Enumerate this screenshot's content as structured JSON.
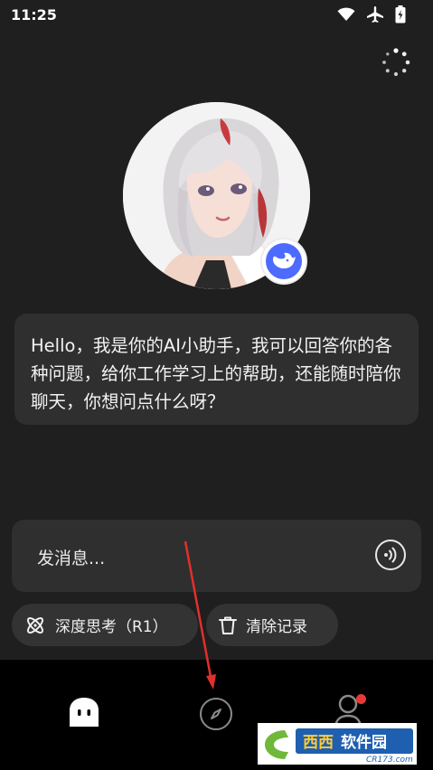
{
  "status_bar": {
    "time": "11:25"
  },
  "greeting": {
    "text": "Hello，我是你的AI小助手，我可以回答你的各种问题，给你工作学习上的帮助，还能随时陪你聊天，你想问点什么呀？"
  },
  "input": {
    "placeholder": "发消息..."
  },
  "chips": {
    "deep_think_label": "深度思考（R1）",
    "clear_label": "清除记录"
  },
  "icons": {
    "status": [
      "wifi-icon",
      "airplane-mode-icon",
      "battery-charging-icon"
    ],
    "top_right": "loading-spinner-icon",
    "badge": "deepseek-whale-icon",
    "voice": "voice-input-icon",
    "deep_think": "atom-icon",
    "clear": "trash-icon",
    "nav": [
      "home-ghost-icon",
      "compass-icon",
      "profile-icon"
    ]
  },
  "watermark": {
    "text": "西西软件园",
    "url": "CR173.com"
  },
  "colors": {
    "background": "#1f1f1f",
    "card": "#2f2f2f",
    "accent": "#4d6bfe",
    "nav_bg": "#000000",
    "notification": "#e53935",
    "arrow": "#e0302a"
  }
}
